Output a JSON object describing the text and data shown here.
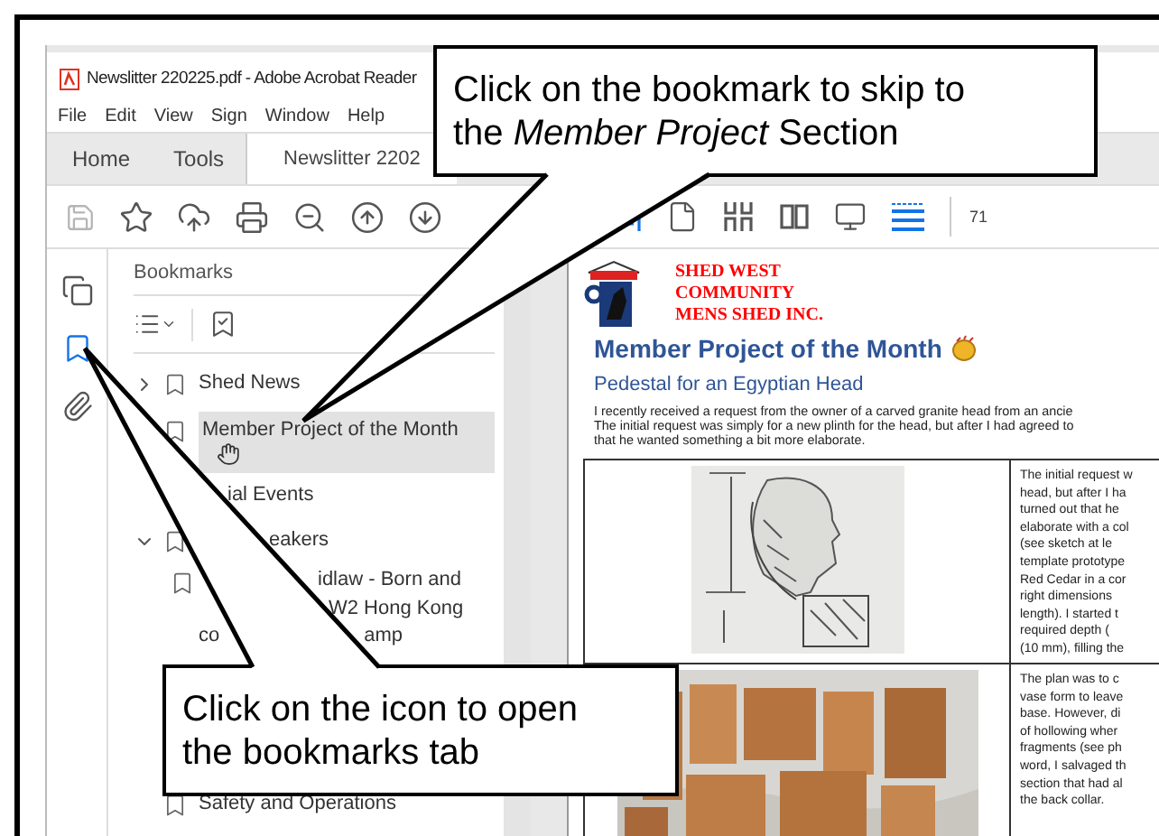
{
  "window": {
    "title": "Newslitter 220225.pdf - Adobe Acrobat Reader"
  },
  "menu": [
    "File",
    "Edit",
    "View",
    "Sign",
    "Window",
    "Help"
  ],
  "tabs": [
    {
      "label": "Home",
      "selected": false
    },
    {
      "label": "Tools",
      "selected": false
    },
    {
      "label": "Newslitter 2202",
      "selected": true
    }
  ],
  "toolbar_left": [
    {
      "kind": "save",
      "disabled": true
    },
    {
      "kind": "star",
      "disabled": false
    },
    {
      "kind": "upload",
      "disabled": false
    },
    {
      "kind": "print",
      "disabled": false
    },
    {
      "kind": "zoom-out",
      "disabled": false
    },
    {
      "kind": "page-up",
      "disabled": false
    },
    {
      "kind": "page-down",
      "disabled": false
    }
  ],
  "toolbar_right": [
    {
      "kind": "fit",
      "selected": true
    },
    {
      "kind": "page",
      "selected": false
    },
    {
      "kind": "grid",
      "selected": false
    },
    {
      "kind": "two-page",
      "selected": false
    },
    {
      "kind": "screen",
      "selected": false
    },
    {
      "kind": "scroll",
      "selected": true
    }
  ],
  "zoom": "71",
  "side_icons": [
    {
      "kind": "pages",
      "selected": false
    },
    {
      "kind": "bookmarks",
      "selected": true
    },
    {
      "kind": "attachments",
      "selected": false
    }
  ],
  "bookmarks": {
    "title": "Bookmarks",
    "items": [
      {
        "label": "Shed News",
        "expanded": false,
        "selected": false
      },
      {
        "label": "Member Project of the Month",
        "selected": true,
        "pointer": true
      },
      {
        "label": "ial Events",
        "selected": false
      },
      {
        "label": "eakers",
        "expanded": true,
        "selected": false,
        "children": [
          {
            "lines": [
              [
                "idlaw - Born and"
              ],
              [
                "W2 Hong Kong"
              ],
              [
                "co",
                "amp"
              ]
            ]
          }
        ]
      },
      {
        "label": "Safety and Operations",
        "selected": false
      }
    ]
  },
  "document": {
    "org": [
      "SHED WEST",
      "COMMUNITY",
      "MENS SHED INC."
    ],
    "heading": "Member Project of the Month",
    "subheading": "Pedestal for an Egyptian Head",
    "intro": [
      "I recently received a request from the owner of a carved granite head from an ancie",
      "The initial request was simply for a new plinth for the head, but after I had agreed to",
      "that he wanted something a bit more elaborate."
    ],
    "rows": [
      {
        "kind": "sketch",
        "lines": [
          "The initial request w",
          "head, but after I ha",
          "turned out that he",
          "elaborate with a col",
          "(see sketch at le",
          "template prototype",
          "Red Cedar in a cor",
          "right dimensions",
          "length). I started t",
          "required depth (",
          "(10 mm), filling the"
        ]
      },
      {
        "lines": [
          "The plan was to c",
          "vase form to leave",
          "base. However, di",
          "of hollowing wher",
          "fragments (see ph",
          "word, I salvaged th",
          "section that had al",
          "the back collar."
        ]
      }
    ]
  },
  "callouts": [
    {
      "lines": [
        "Click on the bookmark to skip to",
        "the *Member Project* Section"
      ]
    },
    {
      "lines": [
        "Click on the icon to open",
        "the bookmarks tab"
      ]
    }
  ]
}
